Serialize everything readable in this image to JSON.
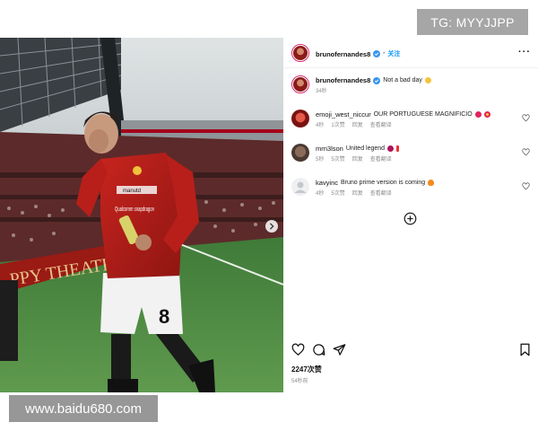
{
  "watermarks": {
    "top_right": "TG: MYYJJPP",
    "bottom_left": "www.baidu680.com"
  },
  "colors": {
    "accent_blue": "#0095f6",
    "verified_blue": "#3897f0",
    "meta_gray": "#8e8e8e",
    "story_ring": "#d62976"
  },
  "header": {
    "username": "brunofernandes8",
    "verified_icon": "verified-badge-icon",
    "separator": "•",
    "follow_label": "关注",
    "more_icon": "more-horizontal-icon"
  },
  "caption": {
    "username": "brunofernandes8",
    "text": "Not a bad day",
    "emoji_icon": "smiling-face-emoji",
    "time": "34秒"
  },
  "comments": [
    {
      "username": "emoji_west_niccur",
      "text": "OUR PORTUGUESE MAGNIFICIO",
      "emojis": [
        "red-heart-emoji",
        "heart-eyes-emoji"
      ],
      "time": "4秒",
      "likes": "1次赞",
      "reply": "回复",
      "translate": "查看翻译"
    },
    {
      "username": "mrn3lson",
      "text": "United legend",
      "emojis": [
        "red-heart-emoji",
        "exclamation-emoji"
      ],
      "time": "5秒",
      "likes": "5次赞",
      "reply": "回复",
      "translate": "查看翻译"
    },
    {
      "username": "kavyinc",
      "text": "Bruno prime version is coming",
      "emojis": [
        "fire-emoji"
      ],
      "time": "4秒",
      "likes": "5次赞",
      "reply": "回复",
      "translate": "查看翻译"
    }
  ],
  "load_more_icon": "plus-circle-icon",
  "actions": {
    "like_icon": "heart-icon",
    "comment_icon": "comment-icon",
    "share_icon": "send-icon",
    "save_icon": "bookmark-icon"
  },
  "likes_count": "2247次赞",
  "post_time": "54秒前",
  "photo": {
    "banner_text": "PPY THEATRE OF",
    "shirt_sponsor": "Qualcomm snapdragon",
    "shirt_brand": "manutd",
    "shirt_number": "8",
    "next_icon": "chevron-right-icon"
  }
}
